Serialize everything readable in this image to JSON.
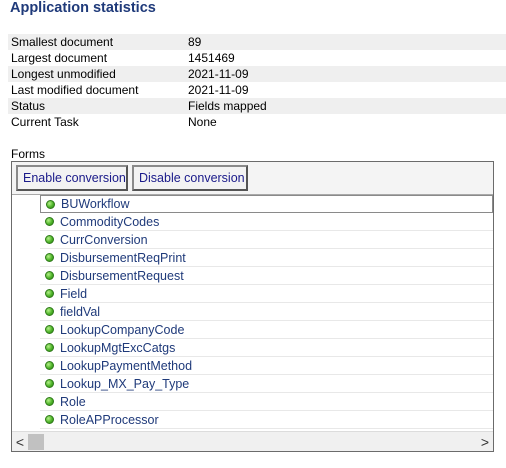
{
  "title": "Application statistics",
  "stats": [
    {
      "label": "Smallest document",
      "value": "89"
    },
    {
      "label": "Largest document",
      "value": "1451469"
    },
    {
      "label": "Longest unmodified",
      "value": "2021-11-09"
    },
    {
      "label": "Last modified document",
      "value": "2021-11-09"
    },
    {
      "label": "Status",
      "value": "Fields mapped"
    },
    {
      "label": "Current Task",
      "value": "None"
    }
  ],
  "forms_label": "Forms",
  "toolbar": {
    "enable_label": "Enable conversion",
    "disable_label": "Disable conversion"
  },
  "forms": [
    "BUWorkflow",
    "CommodityCodes",
    "CurrConversion",
    "DisbursementReqPrint",
    "DisbursementRequest",
    "Field",
    "fieldVal",
    "LookupCompanyCode",
    "LookupMgtExcCatgs",
    "LookupPaymentMethod",
    "Lookup_MX_Pay_Type",
    "Role",
    "RoleAPProcessor"
  ],
  "scrollbar": {
    "left_arrow": "<",
    "right_arrow": ">"
  },
  "colors": {
    "title": "#1f3a7a",
    "status_dot": "#4fb52a",
    "button_text": "#1a1a8a"
  },
  "icons": {
    "form_status": "green-dot-icon"
  }
}
